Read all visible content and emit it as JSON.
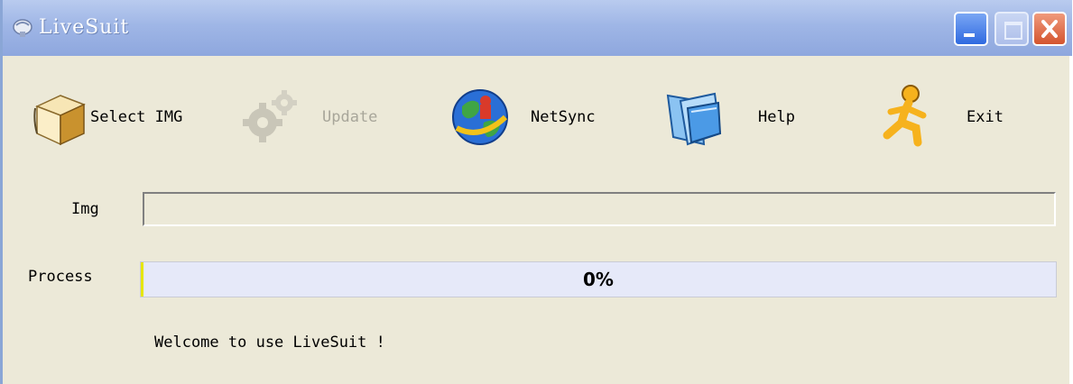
{
  "window": {
    "title": "LiveSuit"
  },
  "toolbar": {
    "select_img": {
      "label": "Select IMG",
      "icon": "box-icon"
    },
    "update": {
      "label": "Update",
      "icon": "gears-icon",
      "enabled": false
    },
    "netsync": {
      "label": "NetSync",
      "icon": "globe-icon"
    },
    "help": {
      "label": "Help",
      "icon": "folder-icon"
    },
    "exit": {
      "label": "Exit",
      "icon": "running-man-icon"
    }
  },
  "form": {
    "img_label": "Img",
    "img_value": "",
    "process_label": "Process",
    "progress_percent": 0,
    "progress_text": "0%"
  },
  "status": {
    "message": "Welcome to use LiveSuit !"
  },
  "colors": {
    "titlebar": "#9fb6e6",
    "window_bg": "#ece9d8",
    "progress_bg": "#e6e9f9"
  }
}
